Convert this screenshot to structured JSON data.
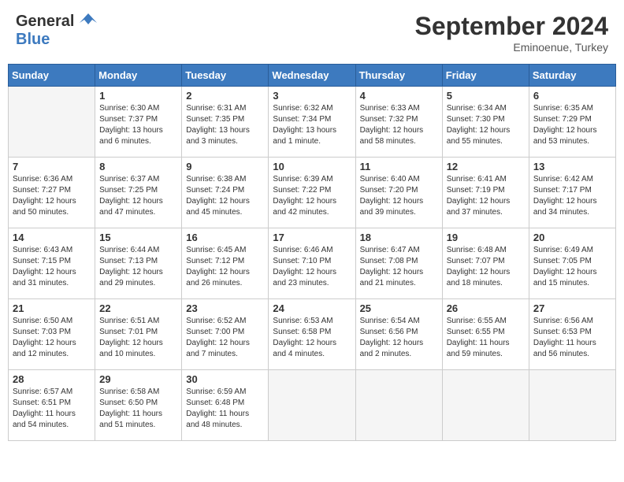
{
  "header": {
    "logo_general": "General",
    "logo_blue": "Blue",
    "month_title": "September 2024",
    "location": "Eminoenue, Turkey"
  },
  "weekdays": [
    "Sunday",
    "Monday",
    "Tuesday",
    "Wednesday",
    "Thursday",
    "Friday",
    "Saturday"
  ],
  "days": [
    {
      "num": "",
      "sunrise": "",
      "sunset": "",
      "daylight": "",
      "empty": true
    },
    {
      "num": "1",
      "sunrise": "Sunrise: 6:30 AM",
      "sunset": "Sunset: 7:37 PM",
      "daylight": "Daylight: 13 hours and 6 minutes."
    },
    {
      "num": "2",
      "sunrise": "Sunrise: 6:31 AM",
      "sunset": "Sunset: 7:35 PM",
      "daylight": "Daylight: 13 hours and 3 minutes."
    },
    {
      "num": "3",
      "sunrise": "Sunrise: 6:32 AM",
      "sunset": "Sunset: 7:34 PM",
      "daylight": "Daylight: 13 hours and 1 minute."
    },
    {
      "num": "4",
      "sunrise": "Sunrise: 6:33 AM",
      "sunset": "Sunset: 7:32 PM",
      "daylight": "Daylight: 12 hours and 58 minutes."
    },
    {
      "num": "5",
      "sunrise": "Sunrise: 6:34 AM",
      "sunset": "Sunset: 7:30 PM",
      "daylight": "Daylight: 12 hours and 55 minutes."
    },
    {
      "num": "6",
      "sunrise": "Sunrise: 6:35 AM",
      "sunset": "Sunset: 7:29 PM",
      "daylight": "Daylight: 12 hours and 53 minutes."
    },
    {
      "num": "7",
      "sunrise": "Sunrise: 6:36 AM",
      "sunset": "Sunset: 7:27 PM",
      "daylight": "Daylight: 12 hours and 50 minutes."
    },
    {
      "num": "8",
      "sunrise": "Sunrise: 6:37 AM",
      "sunset": "Sunset: 7:25 PM",
      "daylight": "Daylight: 12 hours and 47 minutes."
    },
    {
      "num": "9",
      "sunrise": "Sunrise: 6:38 AM",
      "sunset": "Sunset: 7:24 PM",
      "daylight": "Daylight: 12 hours and 45 minutes."
    },
    {
      "num": "10",
      "sunrise": "Sunrise: 6:39 AM",
      "sunset": "Sunset: 7:22 PM",
      "daylight": "Daylight: 12 hours and 42 minutes."
    },
    {
      "num": "11",
      "sunrise": "Sunrise: 6:40 AM",
      "sunset": "Sunset: 7:20 PM",
      "daylight": "Daylight: 12 hours and 39 minutes."
    },
    {
      "num": "12",
      "sunrise": "Sunrise: 6:41 AM",
      "sunset": "Sunset: 7:19 PM",
      "daylight": "Daylight: 12 hours and 37 minutes."
    },
    {
      "num": "13",
      "sunrise": "Sunrise: 6:42 AM",
      "sunset": "Sunset: 7:17 PM",
      "daylight": "Daylight: 12 hours and 34 minutes."
    },
    {
      "num": "14",
      "sunrise": "Sunrise: 6:43 AM",
      "sunset": "Sunset: 7:15 PM",
      "daylight": "Daylight: 12 hours and 31 minutes."
    },
    {
      "num": "15",
      "sunrise": "Sunrise: 6:44 AM",
      "sunset": "Sunset: 7:13 PM",
      "daylight": "Daylight: 12 hours and 29 minutes."
    },
    {
      "num": "16",
      "sunrise": "Sunrise: 6:45 AM",
      "sunset": "Sunset: 7:12 PM",
      "daylight": "Daylight: 12 hours and 26 minutes."
    },
    {
      "num": "17",
      "sunrise": "Sunrise: 6:46 AM",
      "sunset": "Sunset: 7:10 PM",
      "daylight": "Daylight: 12 hours and 23 minutes."
    },
    {
      "num": "18",
      "sunrise": "Sunrise: 6:47 AM",
      "sunset": "Sunset: 7:08 PM",
      "daylight": "Daylight: 12 hours and 21 minutes."
    },
    {
      "num": "19",
      "sunrise": "Sunrise: 6:48 AM",
      "sunset": "Sunset: 7:07 PM",
      "daylight": "Daylight: 12 hours and 18 minutes."
    },
    {
      "num": "20",
      "sunrise": "Sunrise: 6:49 AM",
      "sunset": "Sunset: 7:05 PM",
      "daylight": "Daylight: 12 hours and 15 minutes."
    },
    {
      "num": "21",
      "sunrise": "Sunrise: 6:50 AM",
      "sunset": "Sunset: 7:03 PM",
      "daylight": "Daylight: 12 hours and 12 minutes."
    },
    {
      "num": "22",
      "sunrise": "Sunrise: 6:51 AM",
      "sunset": "Sunset: 7:01 PM",
      "daylight": "Daylight: 12 hours and 10 minutes."
    },
    {
      "num": "23",
      "sunrise": "Sunrise: 6:52 AM",
      "sunset": "Sunset: 7:00 PM",
      "daylight": "Daylight: 12 hours and 7 minutes."
    },
    {
      "num": "24",
      "sunrise": "Sunrise: 6:53 AM",
      "sunset": "Sunset: 6:58 PM",
      "daylight": "Daylight: 12 hours and 4 minutes."
    },
    {
      "num": "25",
      "sunrise": "Sunrise: 6:54 AM",
      "sunset": "Sunset: 6:56 PM",
      "daylight": "Daylight: 12 hours and 2 minutes."
    },
    {
      "num": "26",
      "sunrise": "Sunrise: 6:55 AM",
      "sunset": "Sunset: 6:55 PM",
      "daylight": "Daylight: 11 hours and 59 minutes."
    },
    {
      "num": "27",
      "sunrise": "Sunrise: 6:56 AM",
      "sunset": "Sunset: 6:53 PM",
      "daylight": "Daylight: 11 hours and 56 minutes."
    },
    {
      "num": "28",
      "sunrise": "Sunrise: 6:57 AM",
      "sunset": "Sunset: 6:51 PM",
      "daylight": "Daylight: 11 hours and 54 minutes."
    },
    {
      "num": "29",
      "sunrise": "Sunrise: 6:58 AM",
      "sunset": "Sunset: 6:50 PM",
      "daylight": "Daylight: 11 hours and 51 minutes."
    },
    {
      "num": "30",
      "sunrise": "Sunrise: 6:59 AM",
      "sunset": "Sunset: 6:48 PM",
      "daylight": "Daylight: 11 hours and 48 minutes."
    }
  ]
}
